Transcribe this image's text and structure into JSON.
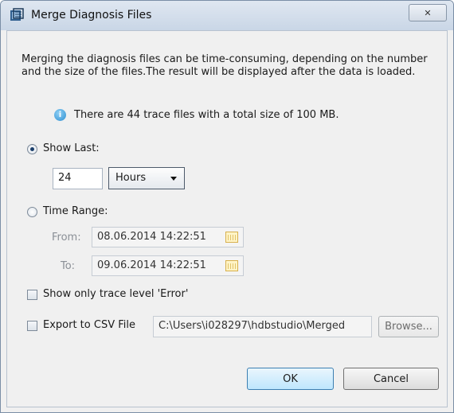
{
  "window": {
    "title": "Merge Diagnosis Files",
    "close_glyph": "✕"
  },
  "description": "Merging the diagnosis files can be time-consuming, depending on the number and the size of the files.The result will be displayed after the data is loaded.",
  "info": {
    "icon": "info-icon",
    "text": "There are 44 trace files with a total size of 100 MB."
  },
  "show_last": {
    "label": "Show Last:",
    "selected": true,
    "amount": "24",
    "unit": "Hours"
  },
  "time_range": {
    "label": "Time Range:",
    "selected": false,
    "from_label": "From:",
    "from_value": "08.06.2014 14:22:51",
    "to_label": "To:",
    "to_value": "09.06.2014 14:22:51"
  },
  "error_only": {
    "label": "Show only trace level 'Error'",
    "checked": false
  },
  "export_csv": {
    "label": "Export to CSV File",
    "checked": false,
    "path": "C:\\Users\\i028297\\hdbstudio\\Merged",
    "browse_label": "Browse..."
  },
  "buttons": {
    "ok": "OK",
    "cancel": "Cancel"
  }
}
